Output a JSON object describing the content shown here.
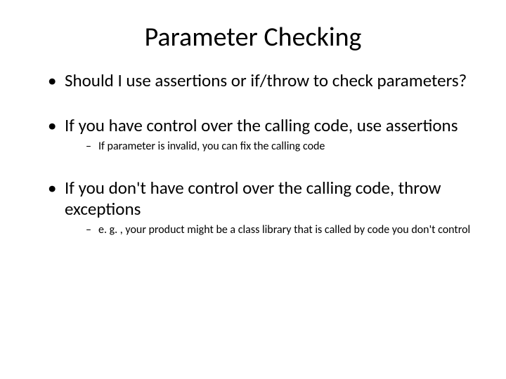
{
  "title": "Parameter Checking",
  "bullets": [
    {
      "text": "Should I use assertions or if/throw to check parameters?",
      "sub": []
    },
    {
      "text": "If you have control over the calling code, use assertions",
      "sub": [
        "If parameter is invalid, you can fix the calling code"
      ]
    },
    {
      "text": "If you don't have control over the calling code, throw exceptions",
      "sub": [
        "e. g. , your product might be a class library that is called by code you don't control"
      ]
    }
  ]
}
